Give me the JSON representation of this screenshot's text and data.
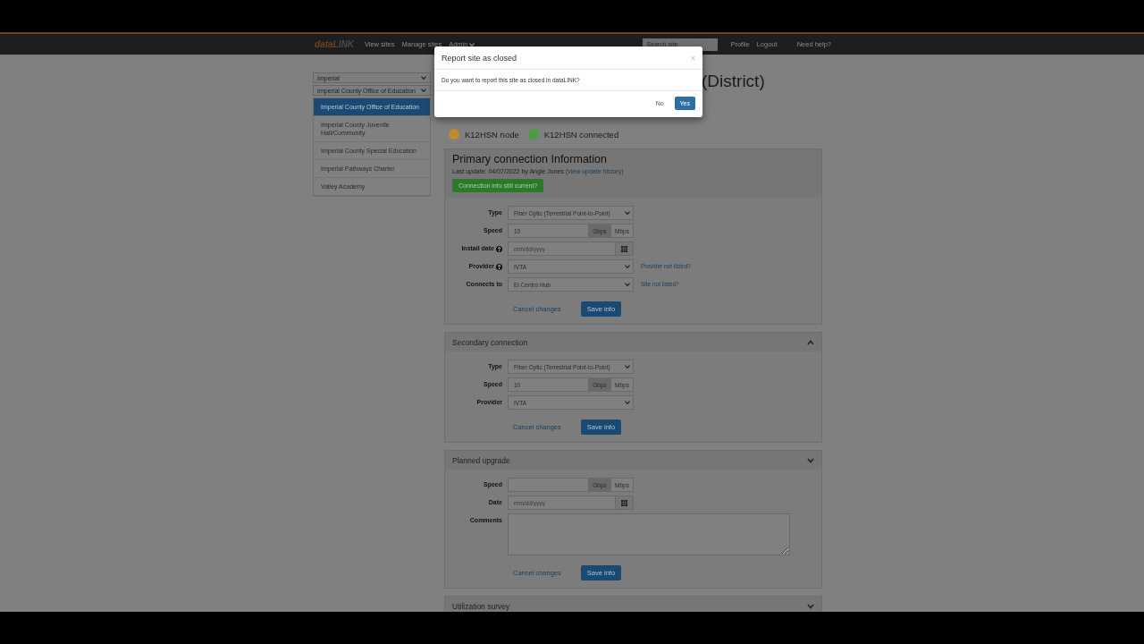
{
  "navbar": {
    "brand": {
      "first": "data",
      "second": "LINK"
    },
    "links": [
      "View sites",
      "Manage sites"
    ],
    "admin_menu": "Admin",
    "search": {
      "placeholder": "Search site"
    },
    "right_links": [
      "Profile",
      "Logout",
      "Need help?"
    ]
  },
  "sidebar": {
    "selects": [
      "Imperial",
      "Imperial County Office of Education"
    ],
    "items": [
      {
        "label": "Imperial County Office of Education",
        "selected": true
      },
      {
        "label": "Imperial County Juvenile Hall/Community",
        "selected": false
      },
      {
        "label": "Imperial County Special Education",
        "selected": false
      },
      {
        "label": "Imperial Pathways Charter",
        "selected": false
      },
      {
        "label": "Valley Academy",
        "selected": false
      }
    ]
  },
  "title": "(District)",
  "legend": [
    {
      "label": "K12HSN node",
      "color": "#c08a30"
    },
    {
      "label": "K12HSN connected",
      "color": "#4a9c44"
    }
  ],
  "sections": [
    {
      "kind": "primary",
      "title": "Primary connection Information",
      "last_update": "Last update: 04/07/2022 by Angie Jones",
      "history_link": "(view update history)",
      "confirm_button": "Connection info still current?",
      "fields": [
        {
          "kind": "select",
          "label": "Type",
          "value": "Fiber Optic (Terrestrial Point-to-Point)",
          "help": false
        },
        {
          "kind": "speed",
          "label": "Speed",
          "value": "10",
          "units": [
            {
              "label": "Gbps",
              "selected": true
            },
            {
              "label": "Mbps",
              "selected": false
            }
          ]
        },
        {
          "kind": "date",
          "label": "Install date",
          "placeholder": "mm/dd/yyyy",
          "help": true
        },
        {
          "kind": "select",
          "label": "Provider",
          "value": "IVTA",
          "help": true,
          "side_link": "Provider not listed?"
        },
        {
          "kind": "select",
          "label": "Connects to",
          "value": "El Centro Hub",
          "help": false,
          "side_link": "Site not listed?"
        }
      ],
      "cancel": "Cancel changes",
      "save": "Save info"
    },
    {
      "kind": "collapsible",
      "title": "Secondary connection",
      "expanded": true,
      "fields": [
        {
          "kind": "select",
          "label": "Type",
          "value": "Fiber Optic (Terrestrial Point-to-Point)",
          "help": false
        },
        {
          "kind": "speed",
          "label": "Speed",
          "value": "10",
          "units": [
            {
              "label": "Gbps",
              "selected": true
            },
            {
              "label": "Mbps",
              "selected": false
            }
          ]
        },
        {
          "kind": "select",
          "label": "Provider",
          "value": "IVTA",
          "help": false
        }
      ],
      "cancel": "Cancel changes",
      "save": "Save info"
    },
    {
      "kind": "collapsible",
      "title": "Planned upgrade",
      "expanded": false,
      "fields": [
        {
          "kind": "speed",
          "label": "Speed",
          "units": [
            {
              "label": "Gbps",
              "selected": true
            },
            {
              "label": "Mbps",
              "selected": false
            }
          ]
        },
        {
          "kind": "date",
          "label": "Date",
          "placeholder": "mm/dd/yyyy",
          "help": false
        },
        {
          "kind": "textarea",
          "label": "Comments"
        }
      ],
      "cancel": "Cancel changes",
      "save": "Save info"
    },
    {
      "kind": "collapsible",
      "title": "Utilization survey",
      "expanded": false
    }
  ],
  "modal": {
    "title": "Report site as closed",
    "close": "×",
    "message": "Do you want to report this site as closed in dataLINK?",
    "buttons": [
      {
        "label": "No",
        "kind": "link"
      },
      {
        "label": "Yes",
        "kind": "primary"
      }
    ]
  }
}
